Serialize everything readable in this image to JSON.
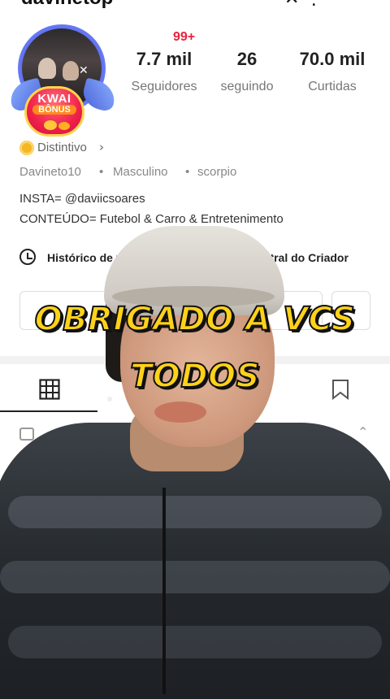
{
  "profile": {
    "handle": "davinetop",
    "badge": {
      "line1": "KWAI",
      "line2": "BÔNUS"
    },
    "notification_count": "99+",
    "stats": [
      {
        "value": "7.7 mil",
        "label": "Seguidores"
      },
      {
        "value": "26",
        "label": "seguindo"
      },
      {
        "value": "70.0 mil",
        "label": "Curtidas"
      }
    ],
    "distintivo_label": "Distintivo",
    "meta": [
      "Davineto10",
      "Masculino",
      "scorpio"
    ],
    "bio": [
      "INSTA= @daviicsoares",
      "CONTEÚDO= Futebol & Carro & Entretenimento"
    ],
    "quick_links": [
      "Histórico de v",
      "Central do Criador"
    ]
  },
  "caption": {
    "line1": "OBRIGADO A VCS",
    "line2": "TODOS"
  },
  "colors": {
    "caption_fill": "#ffd21a",
    "notif_red": "#e8243c",
    "badge_red": "#f0204a"
  },
  "icons": [
    "grid-icon",
    "bookmark-icon",
    "clock-icon",
    "chevron-right-icon",
    "menu-icon"
  ]
}
